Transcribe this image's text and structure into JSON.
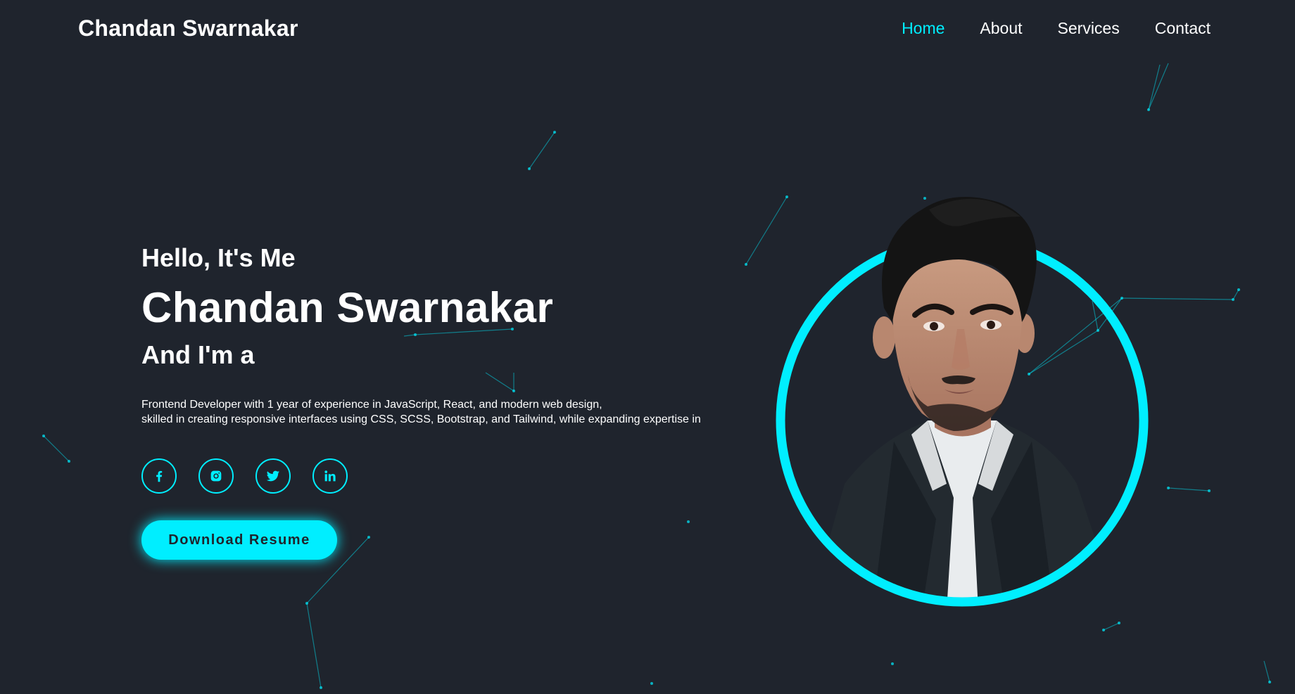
{
  "header": {
    "logo": "Chandan Swarnakar",
    "nav": [
      "Home",
      "About",
      "Services",
      "Contact"
    ],
    "active_nav": "Home"
  },
  "hero": {
    "greeting": "Hello, It's Me",
    "name": "Chandan Swarnakar",
    "role": "And I'm a",
    "bio_line1": "Frontend Developer with 1 year of experience in JavaScript, React, and modern web design,",
    "bio_line2": "skilled in creating responsive interfaces using CSS, SCSS, Bootstrap, and Tailwind, while expanding expertise in",
    "socials": [
      "facebook-icon",
      "instagram-icon",
      "twitter-icon",
      "linkedin-icon"
    ],
    "button_label": "Download Resume"
  },
  "colors": {
    "background": "#1f242d",
    "accent": "#00eeff",
    "text": "#ffffff"
  }
}
